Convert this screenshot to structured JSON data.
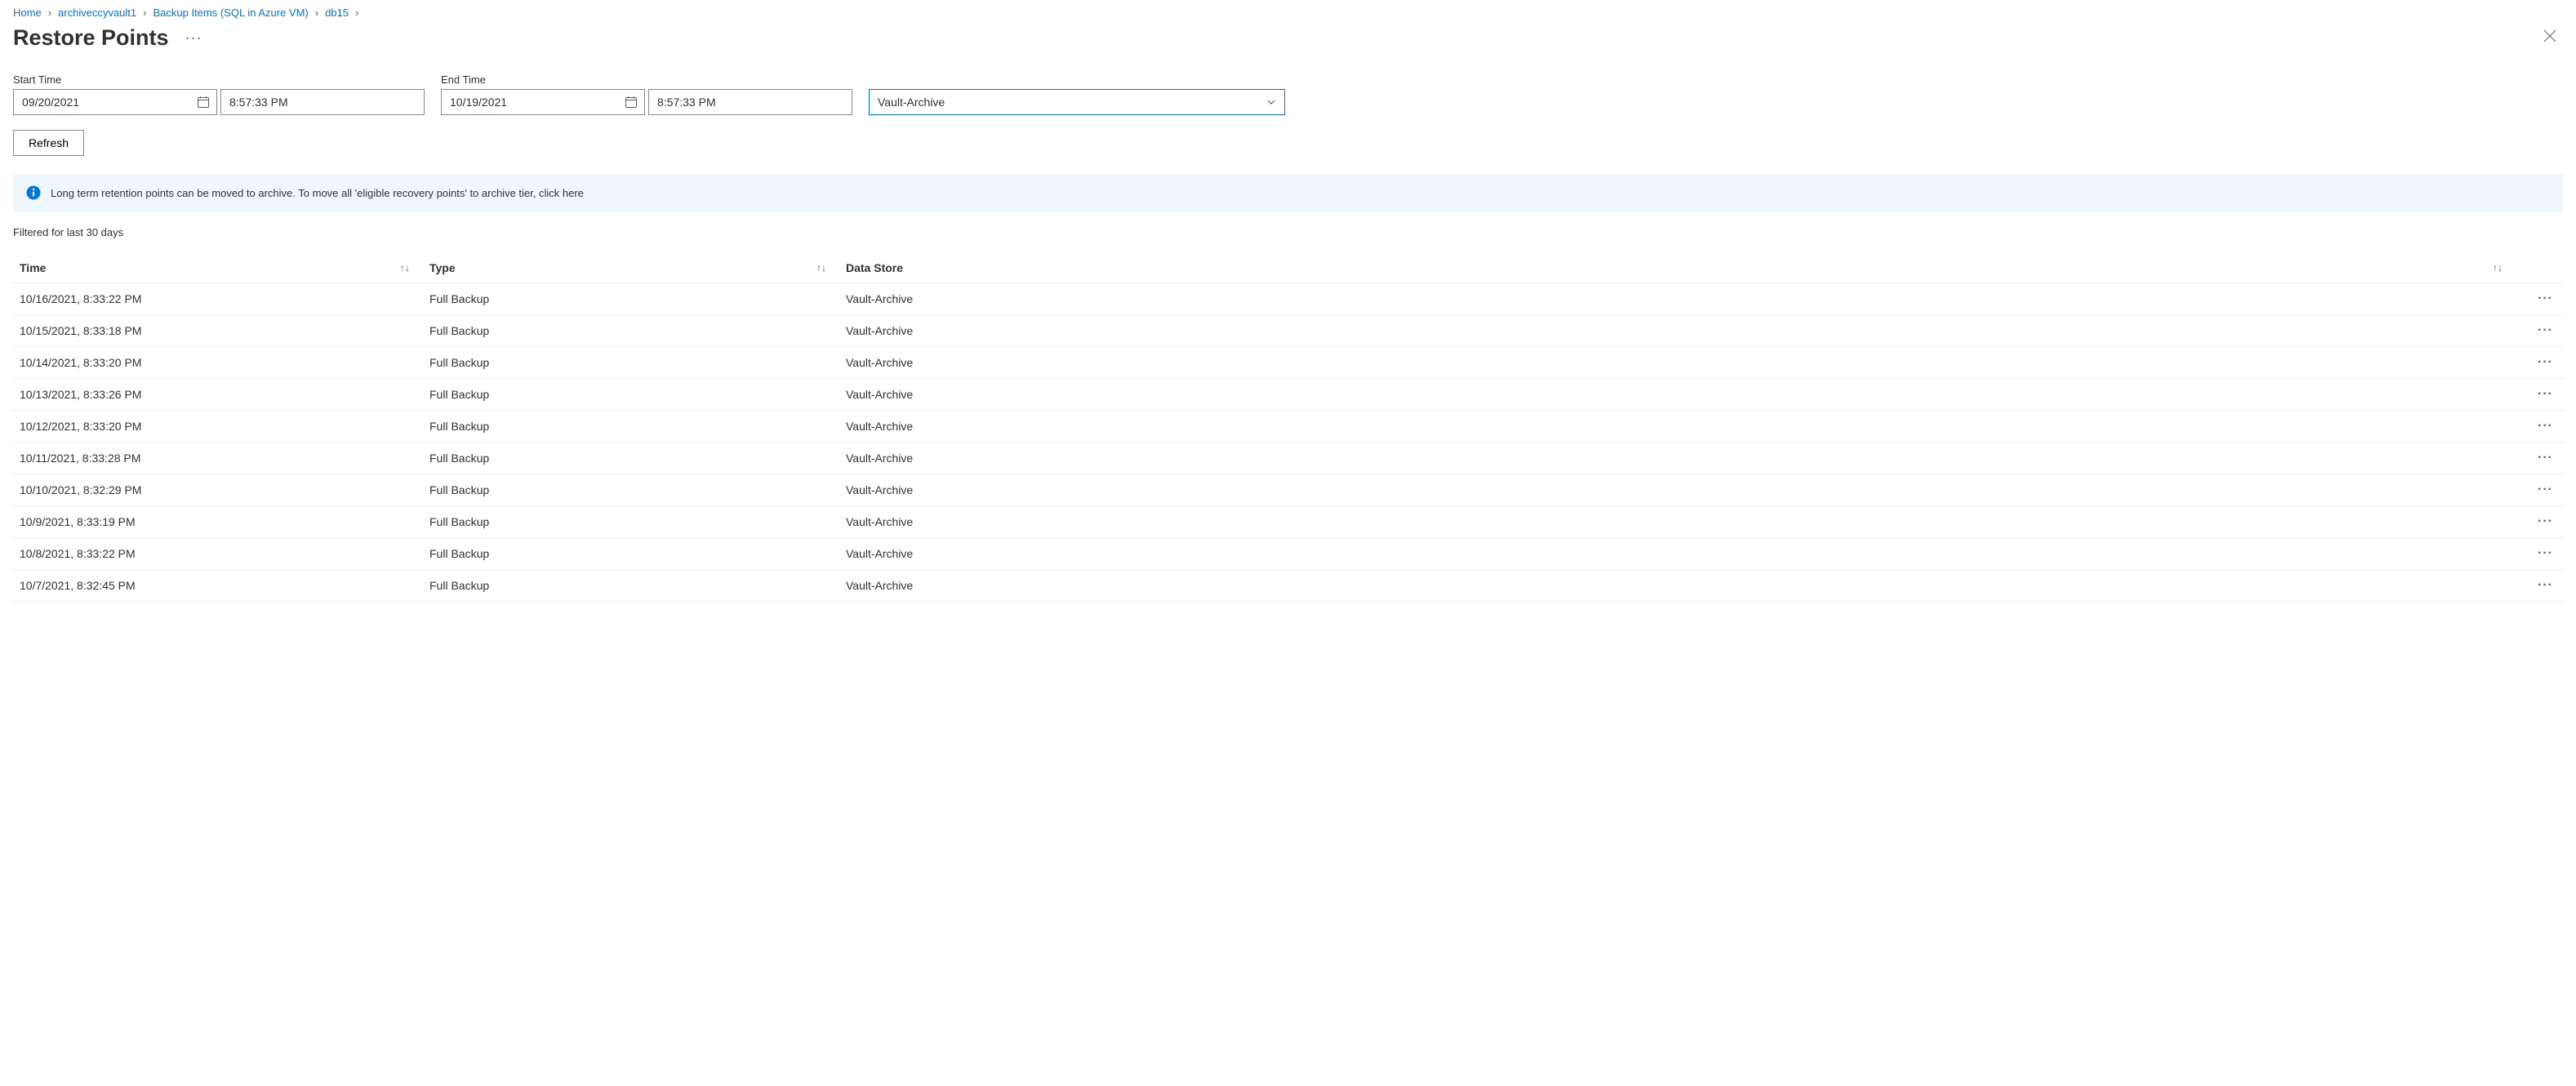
{
  "breadcrumb": {
    "items": [
      {
        "label": "Home"
      },
      {
        "label": "archiveccyvault1"
      },
      {
        "label": "Backup Items (SQL in Azure VM)"
      },
      {
        "label": "db15"
      }
    ]
  },
  "page": {
    "title": "Restore Points"
  },
  "filters": {
    "start_label": "Start Time",
    "start_date": "09/20/2021",
    "start_time": "8:57:33 PM",
    "end_label": "End Time",
    "end_date": "10/19/2021",
    "end_time": "8:57:33 PM",
    "tier_selected": "Vault-Archive"
  },
  "actions": {
    "refresh_label": "Refresh"
  },
  "banner": {
    "text": "Long term retention points can be moved to archive. To move all 'eligible recovery points' to archive tier, click here"
  },
  "summary": {
    "text": "Filtered for last 30 days"
  },
  "table": {
    "headers": {
      "time": "Time",
      "type": "Type",
      "store": "Data Store"
    },
    "rows": [
      {
        "time": "10/16/2021, 8:33:22 PM",
        "type": "Full Backup",
        "store": "Vault-Archive"
      },
      {
        "time": "10/15/2021, 8:33:18 PM",
        "type": "Full Backup",
        "store": "Vault-Archive"
      },
      {
        "time": "10/14/2021, 8:33:20 PM",
        "type": "Full Backup",
        "store": "Vault-Archive"
      },
      {
        "time": "10/13/2021, 8:33:26 PM",
        "type": "Full Backup",
        "store": "Vault-Archive"
      },
      {
        "time": "10/12/2021, 8:33:20 PM",
        "type": "Full Backup",
        "store": "Vault-Archive"
      },
      {
        "time": "10/11/2021, 8:33:28 PM",
        "type": "Full Backup",
        "store": "Vault-Archive"
      },
      {
        "time": "10/10/2021, 8:32:29 PM",
        "type": "Full Backup",
        "store": "Vault-Archive"
      },
      {
        "time": "10/9/2021, 8:33:19 PM",
        "type": "Full Backup",
        "store": "Vault-Archive"
      },
      {
        "time": "10/8/2021, 8:33:22 PM",
        "type": "Full Backup",
        "store": "Vault-Archive"
      },
      {
        "time": "10/7/2021, 8:32:45 PM",
        "type": "Full Backup",
        "store": "Vault-Archive"
      }
    ]
  }
}
